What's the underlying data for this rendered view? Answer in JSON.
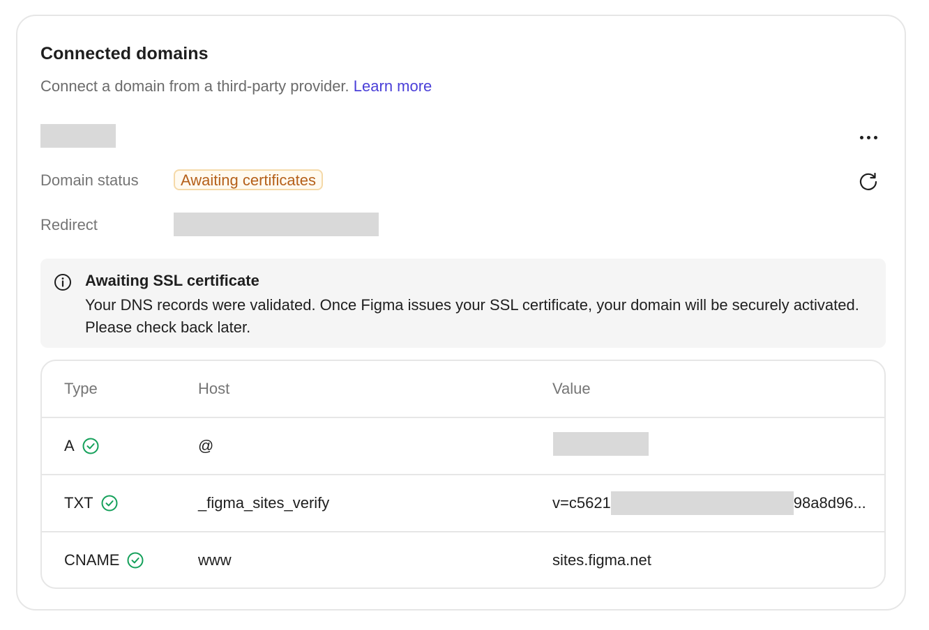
{
  "header": {
    "title": "Connected domains",
    "subtitle": "Connect a domain from a third-party provider.",
    "learn_more": "Learn more"
  },
  "domain": {
    "status_label": "Domain status",
    "status_value": "Awaiting certificates",
    "redirect_label": "Redirect"
  },
  "notice": {
    "title": "Awaiting SSL certificate",
    "body": "Your DNS records were validated. Once Figma issues your SSL certificate, your domain will be securely activated. Please check back later."
  },
  "table": {
    "headers": {
      "type": "Type",
      "host": "Host",
      "value": "Value"
    },
    "rows": [
      {
        "type": "A",
        "host": "@",
        "value": "",
        "status": "verified"
      },
      {
        "type": "TXT",
        "host": "_figma_sites_verify",
        "value_prefix": "v=c5621",
        "value_suffix": "98a8d96...",
        "status": "verified"
      },
      {
        "type": "CNAME",
        "host": "www",
        "value": "sites.figma.net",
        "status": "verified"
      }
    ]
  },
  "icons": {
    "more": "more-horizontal-icon",
    "refresh": "refresh-icon",
    "info": "info-icon",
    "check": "check-circle-icon"
  },
  "colors": {
    "link": "#4a3fd8",
    "badge_text": "#b5601a",
    "badge_border": "#f5d9a8",
    "check_green": "#14a05a"
  }
}
